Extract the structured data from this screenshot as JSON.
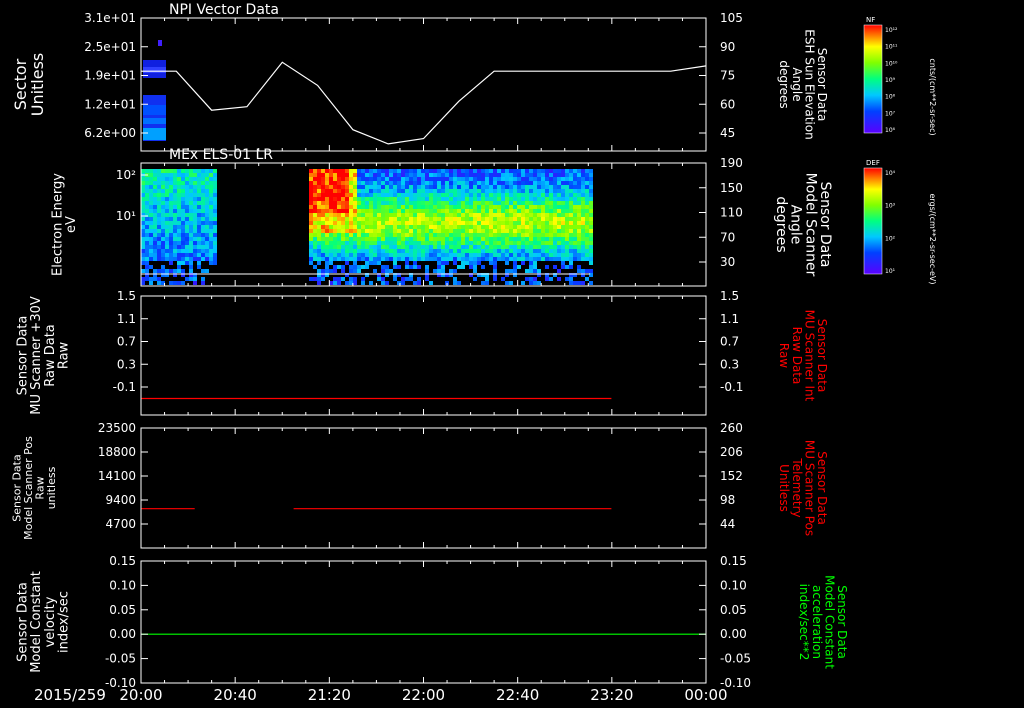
{
  "colors": {
    "background": "#000000",
    "axes": "#ffffff",
    "red_trace": "#ff0000",
    "green_trace": "#00ff00",
    "white_trace": "#ffffff"
  },
  "date_label": "2015/259",
  "time_ticks": [
    "20:00",
    "20:40",
    "21:20",
    "22:00",
    "22:40",
    "23:20",
    "00:00"
  ],
  "chart_data": [
    {
      "type": "heatmap",
      "title": "NPI Vector Data",
      "ylabel": [
        "Sector",
        "Unitless"
      ],
      "yticks": [
        "3.1e+01",
        "2.5e+01",
        "1.9e+01",
        "1.2e+01",
        "6.2e+00"
      ],
      "right_ylabel": [
        "Sensor Data",
        "ESH Sun Elevation",
        "Angle",
        "degrees"
      ],
      "right_yticks": [
        "105",
        "90",
        "75",
        "60",
        "45"
      ],
      "right_ylim": [
        30,
        105
      ],
      "overlay_line": {
        "name": "ESH Sun Elevation Angle",
        "x_hours": [
          0,
          0.25,
          0.5,
          0.75,
          1.0,
          1.25,
          1.5,
          1.75,
          2.0,
          2.25,
          2.5,
          2.75,
          3.0,
          3.25,
          3.5,
          3.75,
          4.0
        ],
        "y": [
          75,
          75,
          53,
          55,
          80,
          67,
          42,
          34,
          37,
          58,
          75,
          75,
          75,
          75,
          75,
          75,
          78
        ]
      },
      "colorbar": {
        "label": "NF",
        "unit": "cnts/(cm**2-sr-sec)",
        "ticks": [
          "10¹²",
          "10¹¹",
          "10¹⁰",
          "10⁹",
          "10⁸",
          "10⁷",
          "10⁶"
        ]
      }
    },
    {
      "type": "heatmap",
      "title": "MEx ELS-01 LR",
      "ylabel": [
        "Electron Energy",
        "eV"
      ],
      "yticks": [
        "10²",
        "10¹"
      ],
      "right_ylabel": [
        "Sensor Data",
        "Model Scanner",
        "Angle",
        "degrees"
      ],
      "right_yticks": [
        "190",
        "150",
        "110",
        "70",
        "30"
      ],
      "colorbar": {
        "label": "DEF",
        "unit": "ergs/(cm**2-sr-sec-eV)",
        "ticks": [
          "10⁴",
          "10³",
          "10²",
          "10¹"
        ]
      }
    },
    {
      "type": "line",
      "ylabel": [
        "Sensor Data",
        "MU Scanner +30V",
        "Raw Data",
        "Raw"
      ],
      "yticks": [
        "1.5",
        "1.1",
        "0.7",
        "0.3",
        "-0.1"
      ],
      "ylim": [
        -0.3,
        1.5
      ],
      "right_ylabel": [
        "Sensor Data",
        "MU Scanner Int",
        "Raw Data",
        "Raw"
      ],
      "right_yticks": [
        "1.5",
        "1.1",
        "0.7",
        "0.3",
        "-0.1"
      ],
      "series": [
        {
          "color": "#ff0000",
          "x_hours": [
            0,
            3.33
          ],
          "y": [
            -0.05,
            -0.05
          ]
        }
      ]
    },
    {
      "type": "line",
      "ylabel": [
        "Sensor Data",
        "Model Scanner Pos",
        "Raw",
        "unitless"
      ],
      "yticks": [
        "23500",
        "18800",
        "14100",
        "9400",
        "4700"
      ],
      "ylim": [
        0,
        23500
      ],
      "right_ylabel": [
        "Sensor Data",
        "MU Scanner Pos",
        "Telemetry",
        "Unitless"
      ],
      "right_yticks": [
        "260",
        "206",
        "152",
        "98",
        "44"
      ],
      "series": [
        {
          "color": "#ff0000",
          "x_hours": [
            0,
            0.38
          ],
          "y": [
            7700,
            7700
          ]
        },
        {
          "color": "#ff0000",
          "x_hours": [
            1.08,
            3.33
          ],
          "y": [
            7700,
            7700
          ]
        }
      ]
    },
    {
      "type": "line",
      "ylabel": [
        "Sensor Data",
        "Model Constant",
        "velocity",
        "index/sec"
      ],
      "yticks": [
        "0.15",
        "0.10",
        "0.05",
        "0.00",
        "-0.05",
        "-0.10"
      ],
      "ylim": [
        -0.1,
        0.15
      ],
      "right_ylabel": [
        "Sensor Data",
        "Model Constant",
        "acceleration",
        "index/sec**2"
      ],
      "right_yticks": [
        "0.15",
        "0.10",
        "0.05",
        "0.00",
        "-0.05",
        "-0.10"
      ],
      "series": [
        {
          "color": "#00ff00",
          "x_hours": [
            0,
            4.0
          ],
          "y": [
            0,
            0
          ]
        }
      ]
    }
  ]
}
